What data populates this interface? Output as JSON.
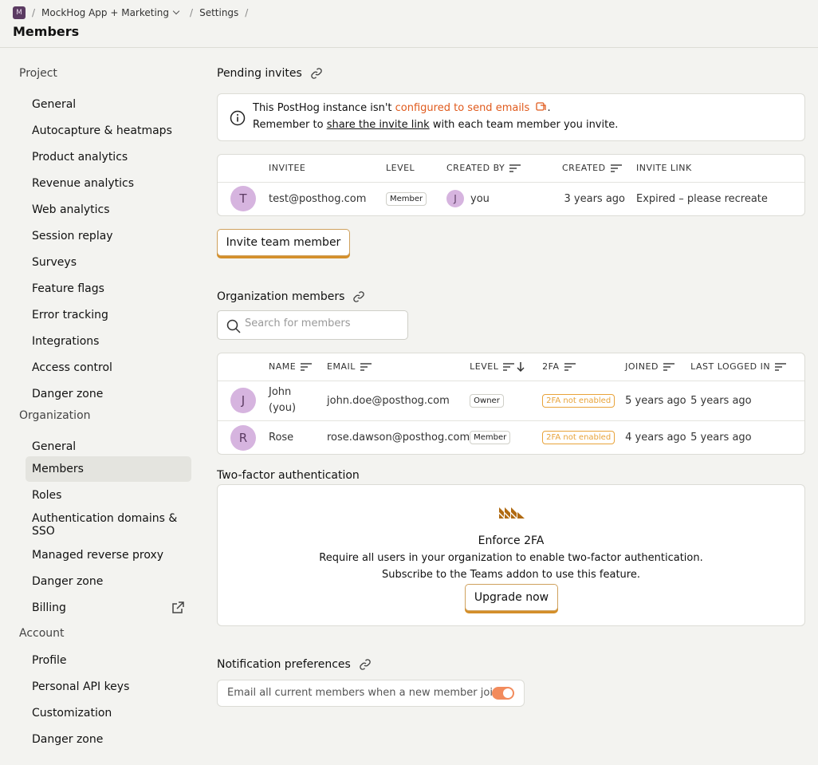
{
  "breadcrumb": {
    "org_initial": "M",
    "project": "MockHog App + Marketing",
    "section": "Settings"
  },
  "page_title": "Members",
  "sidebar": {
    "project_header": "Project",
    "project_items": [
      "General",
      "Autocapture & heatmaps",
      "Product analytics",
      "Revenue analytics",
      "Web analytics",
      "Session replay",
      "Surveys",
      "Feature flags",
      "Error tracking",
      "Integrations",
      "Access control",
      "Danger zone"
    ],
    "org_header": "Organization",
    "org_items": [
      "General",
      "Members",
      "Roles",
      "Authentication domains & SSO",
      "Managed reverse proxy",
      "Danger zone",
      "Billing"
    ],
    "account_header": "Account",
    "account_items": [
      "Profile",
      "Personal API keys",
      "Customization",
      "Danger zone"
    ]
  },
  "pending": {
    "title": "Pending invites",
    "banner_pre": "This PostHog instance isn't ",
    "banner_link": "configured to send emails",
    "banner_post": ".",
    "banner2_pre": "Remember to ",
    "banner2_link": "share the invite link",
    "banner2_post": " with each team member you invite.",
    "columns": [
      "INVITEE",
      "LEVEL",
      "CREATED BY",
      "CREATED",
      "INVITE LINK"
    ],
    "row": {
      "initial": "T",
      "email": "test@posthog.com",
      "level": "Member",
      "creator_initial": "J",
      "creator": "you",
      "created": "3 years ago",
      "link": "Expired – please recreate"
    },
    "invite_button": "Invite team member"
  },
  "members": {
    "title": "Organization members",
    "search_placeholder": "Search for members",
    "columns": [
      "NAME",
      "EMAIL",
      "LEVEL",
      "2FA",
      "JOINED",
      "LAST LOGGED IN"
    ],
    "rows": [
      {
        "initial": "J",
        "name": "John",
        "name2": "(you)",
        "email": "john.doe@posthog.com",
        "level": "Owner",
        "tfa": "2FA not enabled",
        "joined": "5 years ago",
        "last": "5 years ago"
      },
      {
        "initial": "R",
        "name": "Rose",
        "name2": "",
        "email": "rose.dawson@posthog.com",
        "level": "Member",
        "tfa": "2FA not enabled",
        "joined": "4 years ago",
        "last": "5 years ago"
      }
    ]
  },
  "twofa": {
    "title": "Two-factor authentication",
    "heading": "Enforce 2FA",
    "line1": "Require all users in your organization to enable two-factor authentication.",
    "line2": "Subscribe to the Teams addon to use this feature.",
    "button": "Upgrade now"
  },
  "notifications": {
    "title": "Notification preferences",
    "toggle_label": "Email all current members when a new member joins",
    "toggle_on": true
  },
  "colors": {
    "accent": "#e05a1c",
    "button_border": "#d48f2a",
    "avatar": "#d6b4df",
    "warn": "#e8a33a"
  }
}
